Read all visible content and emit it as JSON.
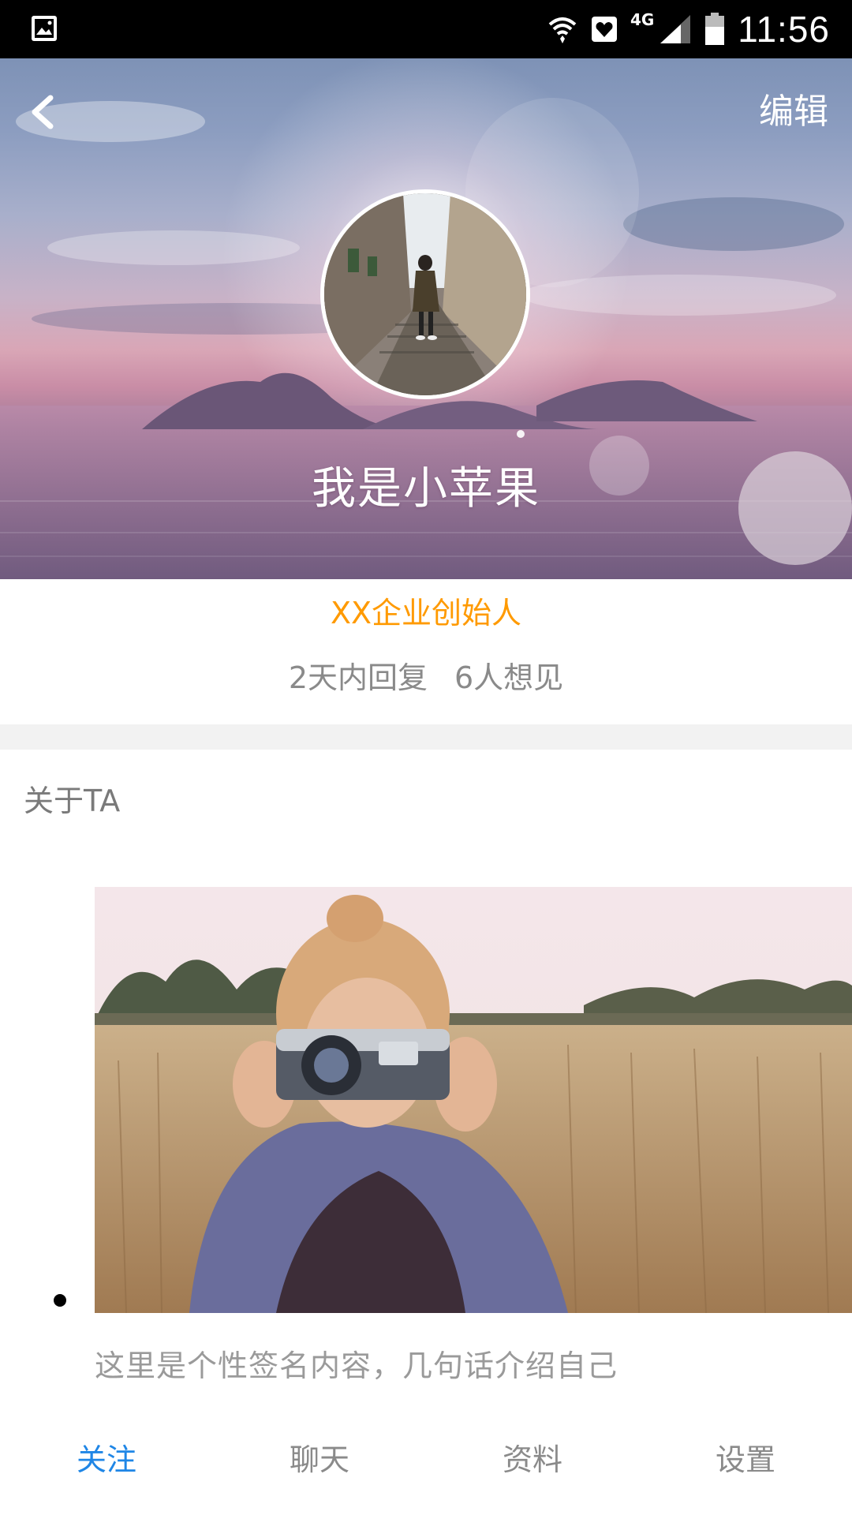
{
  "status_bar": {
    "time": "11:56",
    "network": "4G",
    "icons": [
      "gallery-icon",
      "wifi-icon",
      "heart-icon",
      "signal-icon",
      "battery-icon"
    ]
  },
  "header": {
    "edit_label": "编辑",
    "name": "我是小苹果",
    "back_icon": "back-chevron-icon"
  },
  "profile": {
    "role": "XX企业创始人",
    "reply_time": "2天内回复",
    "want_to_meet": "6人想见"
  },
  "about": {
    "title": "关于TA",
    "signature": "这里是个性签名内容，几句话介绍自己"
  },
  "tabs": [
    {
      "label": "关注",
      "active": true
    },
    {
      "label": "聊天",
      "active": false
    },
    {
      "label": "资料",
      "active": false
    },
    {
      "label": "设置",
      "active": false
    }
  ],
  "colors": {
    "accent": "#1f86e6",
    "role_text": "#ff9a00",
    "muted_text": "#8a8a8a"
  }
}
